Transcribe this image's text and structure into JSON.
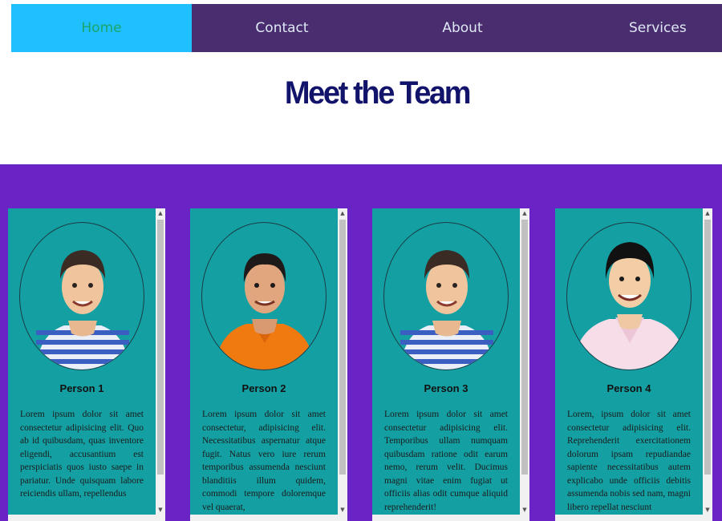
{
  "nav": {
    "items": [
      {
        "label": "Home",
        "active": true
      },
      {
        "label": "Contact",
        "active": false
      },
      {
        "label": "About",
        "active": false
      },
      {
        "label": "Services",
        "active": false
      }
    ]
  },
  "page": {
    "title": "Meet the Team"
  },
  "colors": {
    "nav_bg": "#4a2d6e",
    "nav_active_bg": "#1ec0ff",
    "title": "#12146b",
    "section_bg": "#6a24c6",
    "card_bg": "#14a0a3"
  },
  "team": [
    {
      "name": "Person 1",
      "avatar": "man-striped-shirt-avatar",
      "bio": "Lorem ipsum dolor sit amet consectetur adipisicing elit. Quo ab id quibusdam, quas inventore eligendi, accusantium est perspiciatis quos iusto saepe in pariatur. Unde quisquam labore reiciendis ullam, repellendus"
    },
    {
      "name": "Person 2",
      "avatar": "man-orange-polo-avatar",
      "bio": "Lorem ipsum dolor sit amet consectetur, adipisicing elit. Necessitatibus aspernatur atque fugit. Natus vero iure rerum temporibus assumenda nesciunt blanditiis illum quidem, commodi tempore doloremque vel quaerat,"
    },
    {
      "name": "Person 3",
      "avatar": "man-striped-shirt-avatar",
      "bio": "Lorem ipsum dolor sit amet consectetur adipisicing elit. Temporibus ullam numquam quibusdam ratione odit earum nemo, rerum velit. Ducimus magni vitae enim fugiat ut officiis alias odit cumque aliquid reprehenderit!"
    },
    {
      "name": "Person 4",
      "avatar": "man-pink-shirt-avatar",
      "bio": "Lorem, ipsum dolor sit amet consectetur adipisicing elit. Reprehenderit exercitationem dolorum ipsam repudiandae sapiente necessitatibus autem explicabo unde officiis debitis assumenda nobis sed nam, magni libero repellat nesciunt"
    }
  ]
}
